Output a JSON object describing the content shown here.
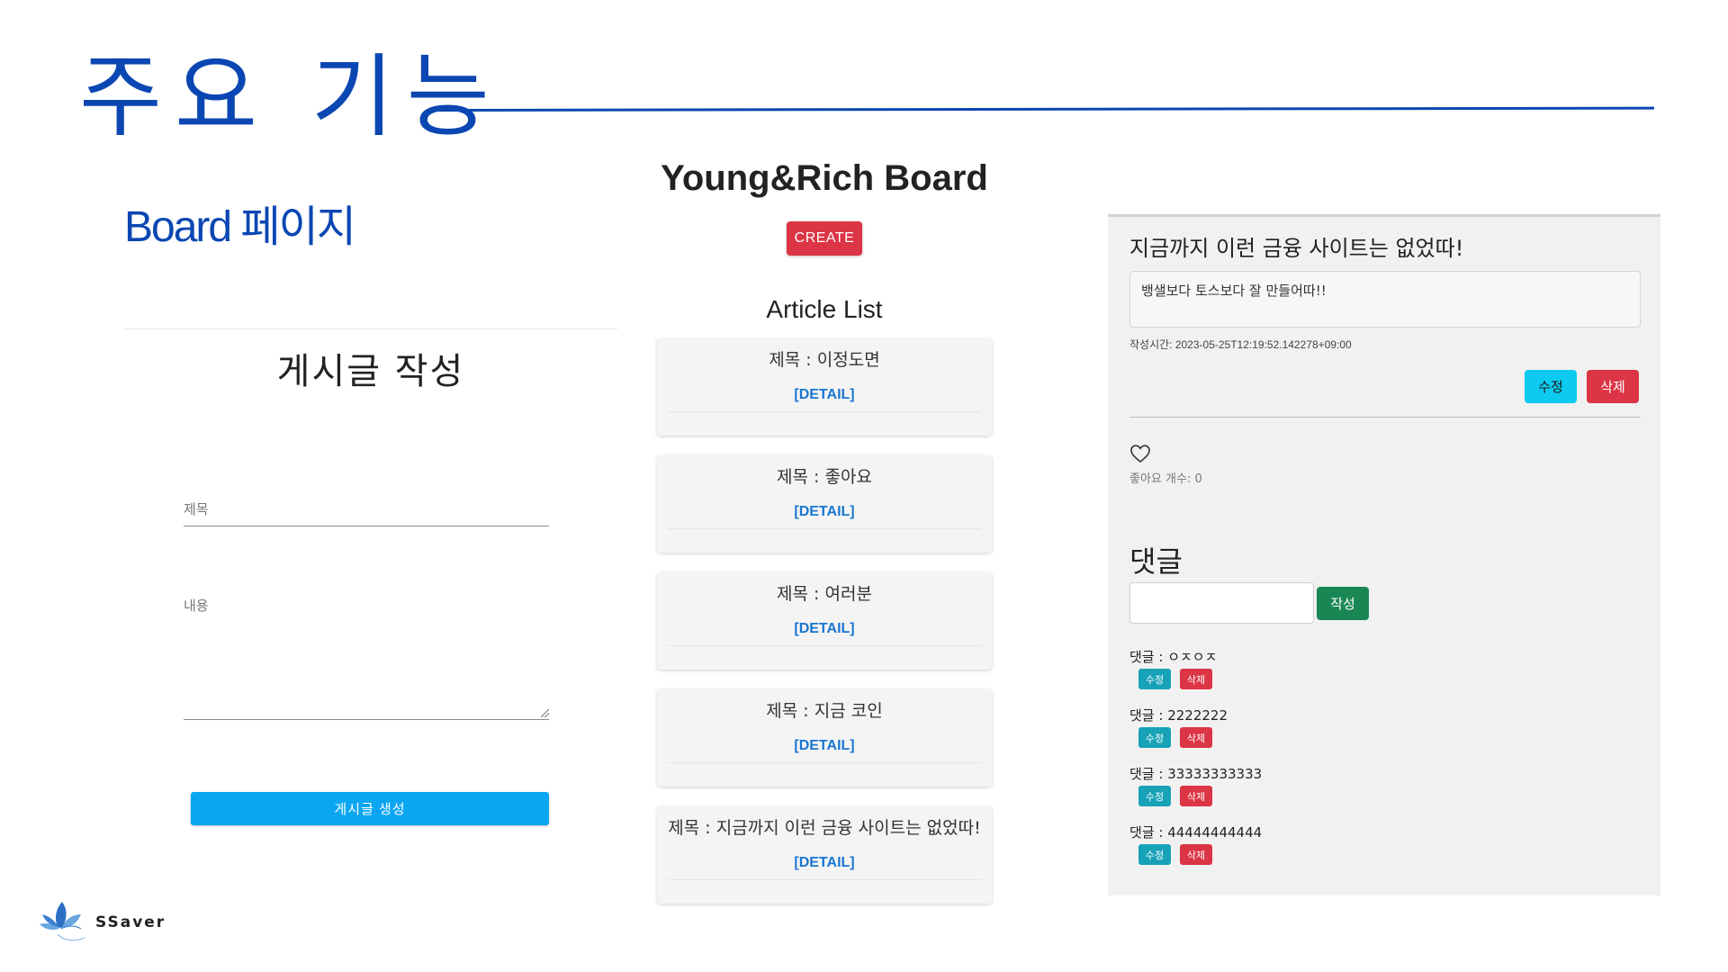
{
  "slide": {
    "title": "주요 기능",
    "section_label": "Board 페이지"
  },
  "create_form": {
    "heading": "게시글 작성",
    "title_label": "제목",
    "content_label": "내용",
    "submit_label": "게시글 생성"
  },
  "board": {
    "title": "Young&Rich Board",
    "create_label": "CREATE",
    "list_heading": "Article List",
    "articles": [
      {
        "title": "제목 : 이정도면",
        "link": "[DETAIL]"
      },
      {
        "title": "제목 : 좋아요",
        "link": "[DETAIL]"
      },
      {
        "title": "제목 : 여러분",
        "link": "[DETAIL]"
      },
      {
        "title": "제목 : 지금 코인",
        "link": "[DETAIL]"
      },
      {
        "title": "제목 : 지금까지 이런 금융 사이트는 없었따!",
        "link": "[DETAIL]"
      }
    ]
  },
  "detail": {
    "title": "지금까지 이런 금융 사이트는 없었따!",
    "body": "뱅샐보다 토스보다 잘 만들어따!!",
    "created_at": "작성시간: 2023-05-25T12:19:52.142278+09:00",
    "edit_label": "수정",
    "delete_label": "삭제",
    "like_label": "좋아요 개수: 0",
    "comment_heading": "댓글",
    "comment_submit_label": "작성",
    "comments": [
      {
        "text": "댓글 : ㅇㅈㅇㅈ",
        "edit": "수정",
        "delete": "삭제"
      },
      {
        "text": "댓글 : 2222222",
        "edit": "수정",
        "delete": "삭제"
      },
      {
        "text": "댓글 : 33333333333",
        "edit": "수정",
        "delete": "삭제"
      },
      {
        "text": "댓글 : 44444444444",
        "edit": "수정",
        "delete": "삭제"
      }
    ]
  },
  "logo": {
    "text": "SSaver"
  },
  "colors": {
    "slide_blue": "#0b47b3",
    "create_red": "#dc3545",
    "submit_blue": "#0aa6f2",
    "link_blue": "#1976d2",
    "edit_cyan": "#0dcaf0",
    "comment_green": "#198754"
  }
}
